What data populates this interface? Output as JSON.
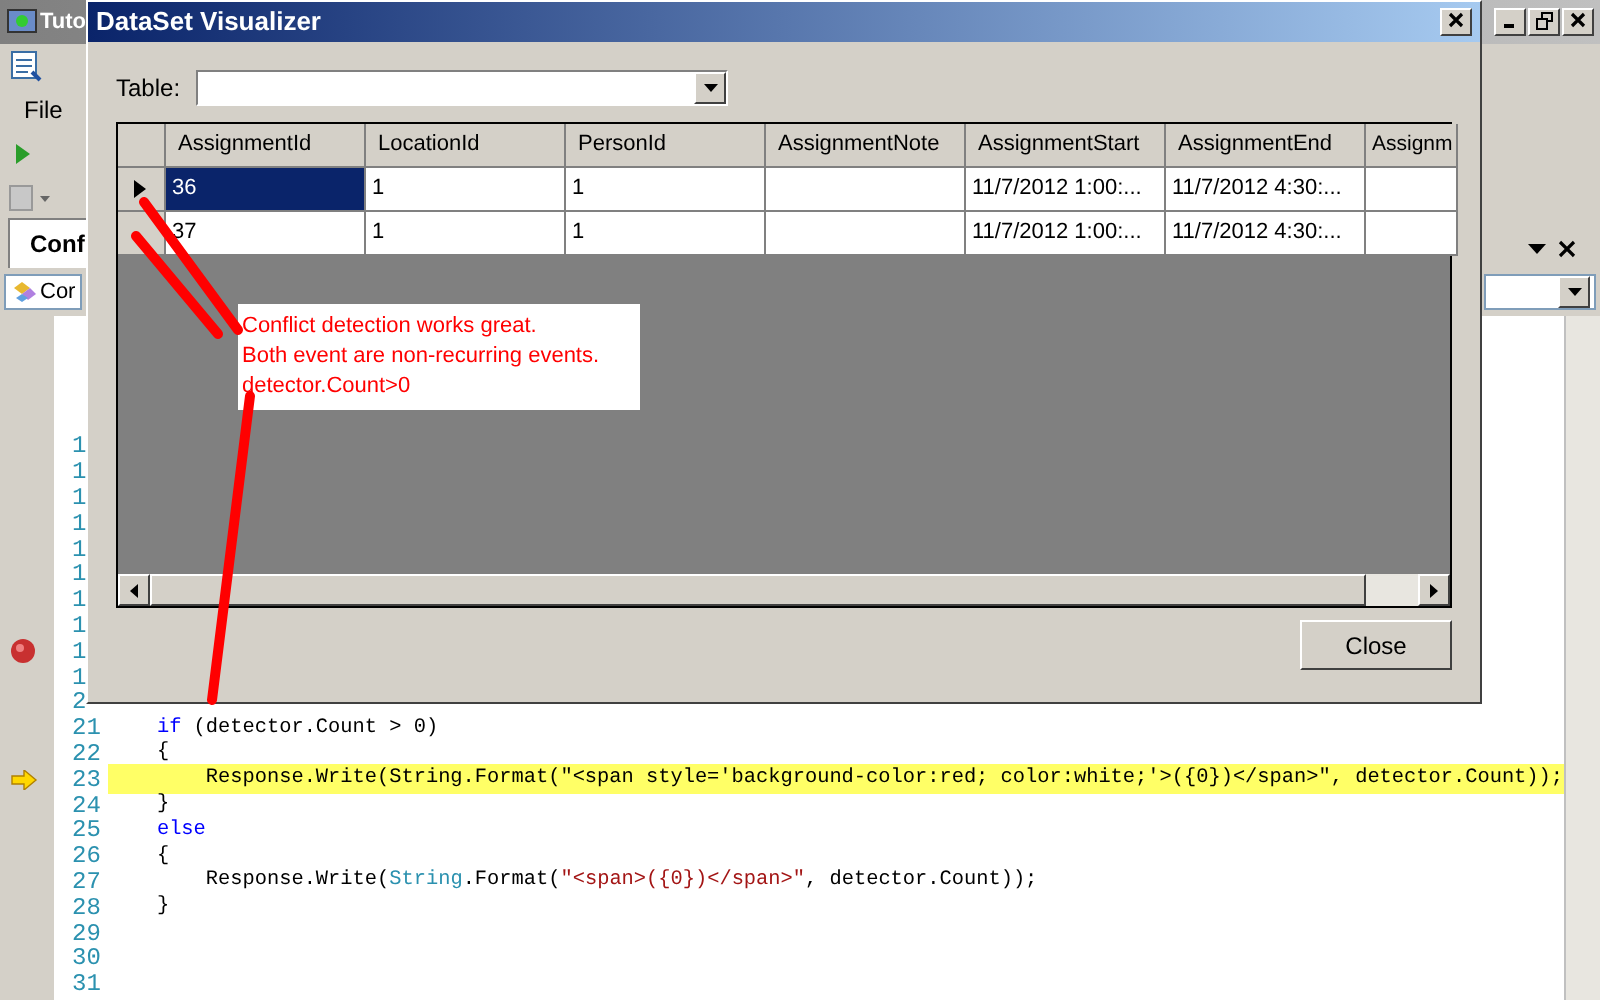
{
  "ide": {
    "title": "Tuto",
    "menu": [
      "File"
    ],
    "tab": {
      "label": "Conf",
      "selected": true
    },
    "combo": "Cor"
  },
  "editor": {
    "lines": [
      {
        "number": "1"
      },
      {
        "number": "1"
      },
      {
        "number": "1"
      },
      {
        "number": "1"
      },
      {
        "number": "1"
      },
      {
        "number": "1"
      },
      {
        "number": "1"
      },
      {
        "number": "1"
      },
      {
        "number": "1",
        "breakpoint": true
      },
      {
        "number": "1"
      },
      {
        "number": "2"
      },
      {
        "number": "21",
        "segments": [
          {
            "kind": "keyword",
            "text": "    if"
          },
          {
            "kind": "plain",
            "text": " (detector.Count > 0)"
          }
        ]
      },
      {
        "number": "22",
        "segments": [
          {
            "kind": "plain",
            "text": "    {"
          }
        ]
      },
      {
        "number": "23",
        "current": true,
        "segments": [
          {
            "kind": "plain",
            "text": "        Response.Write(String.Format(\"<span style='background-color:red; color:white;'>({0})</span>\", detector.Count));"
          }
        ]
      },
      {
        "number": "24",
        "segments": [
          {
            "kind": "plain",
            "text": "    }"
          }
        ]
      },
      {
        "number": "25",
        "segments": [
          {
            "kind": "keyword",
            "text": "    else"
          }
        ]
      },
      {
        "number": "26",
        "segments": [
          {
            "kind": "plain",
            "text": "    {"
          }
        ]
      },
      {
        "number": "27",
        "segments": [
          {
            "kind": "plain",
            "text": "        Response.Write("
          },
          {
            "kind": "type",
            "text": "String"
          },
          {
            "kind": "plain",
            "text": ".Format("
          },
          {
            "kind": "string",
            "text": "\"<span>({0})</span>\""
          },
          {
            "kind": "plain",
            "text": ", detector.Count));"
          }
        ]
      },
      {
        "number": "28",
        "segments": [
          {
            "kind": "plain",
            "text": "    }"
          }
        ]
      },
      {
        "number": "29"
      },
      {
        "number": "30"
      },
      {
        "number": "31"
      }
    ]
  },
  "dialog": {
    "title": "DataSet Visualizer",
    "table_label": "Table:",
    "columns": [
      "AssignmentId",
      "LocationId",
      "PersonId",
      "AssignmentNote",
      "AssignmentStart",
      "AssignmentEnd",
      "Assignm"
    ],
    "rows": [
      {
        "current": true,
        "selected": true,
        "cells": [
          "36",
          "1",
          "1",
          "",
          "11/7/2012 1:00:...",
          "11/7/2012 4:30:...",
          ""
        ]
      },
      {
        "current": false,
        "selected": false,
        "cells": [
          "37",
          "1",
          "1",
          "",
          "11/7/2012 1:00:...",
          "11/7/2012 4:30:...",
          ""
        ]
      }
    ],
    "close_button": "Close"
  },
  "annotation": {
    "lines": [
      "Conflict detection works great.",
      "Both event are non-recurring events.",
      "detector.Count>0"
    ]
  }
}
